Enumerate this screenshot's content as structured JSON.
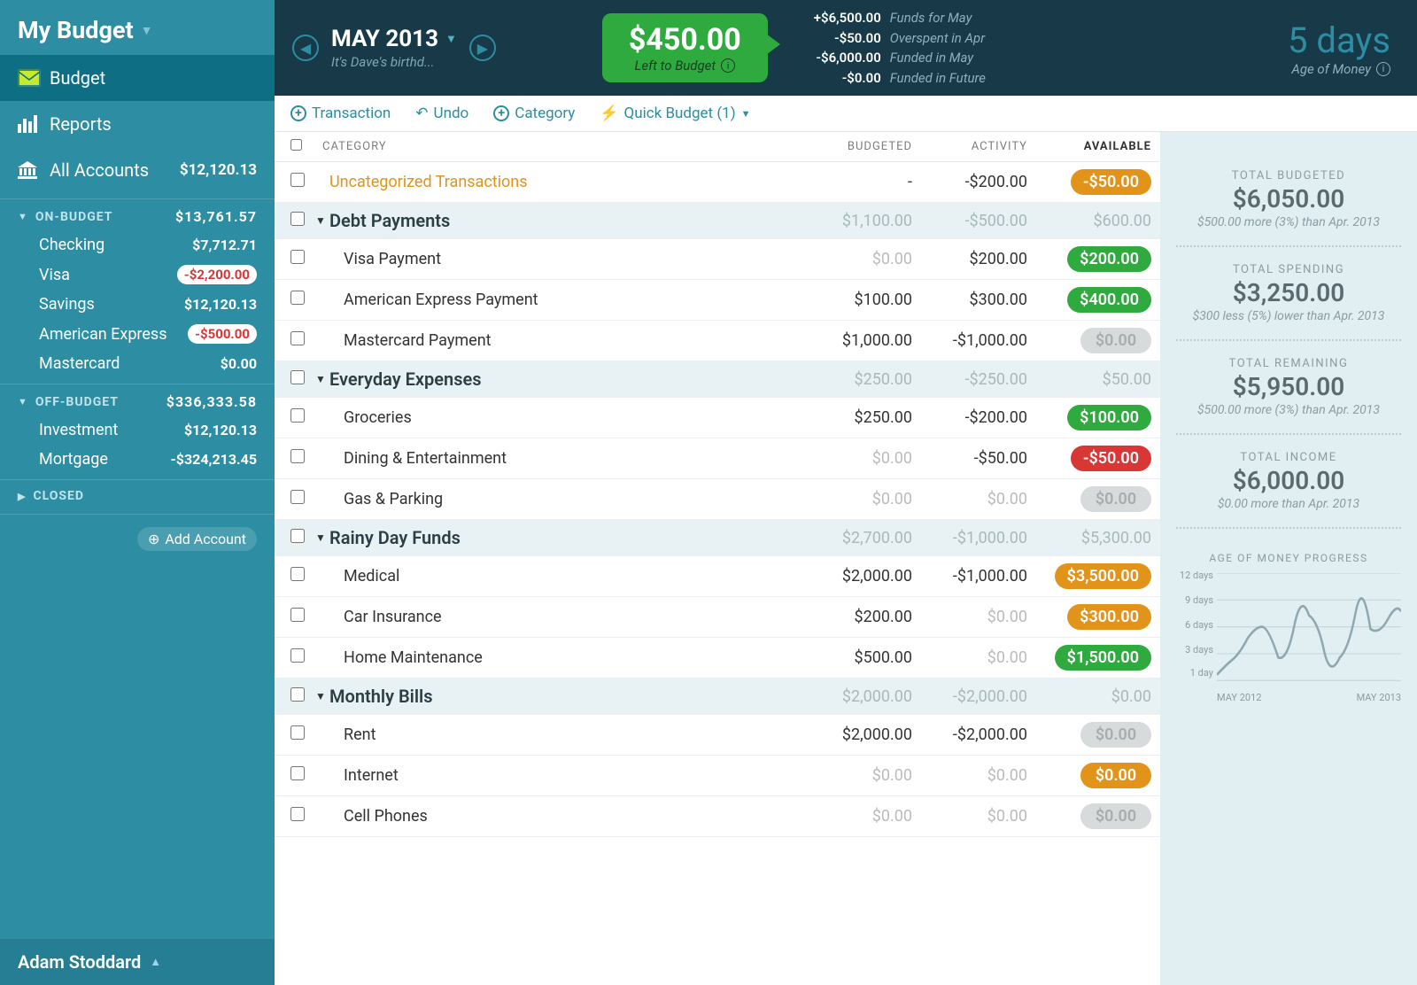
{
  "sidebar": {
    "budget_name": "My Budget",
    "nav": {
      "budget": "Budget",
      "reports": "Reports",
      "all_accounts": "All Accounts",
      "all_accounts_balance": "$12,120.13"
    },
    "on_budget": {
      "label": "ON-BUDGET",
      "total": "$13,761.57",
      "accounts": [
        {
          "name": "Checking",
          "bal": "$7,712.71",
          "neg": false
        },
        {
          "name": "Visa",
          "bal": "-$2,200.00",
          "neg": true
        },
        {
          "name": "Savings",
          "bal": "$12,120.13",
          "neg": false
        },
        {
          "name": "American Express",
          "bal": "-$500.00",
          "neg": true
        },
        {
          "name": "Mastercard",
          "bal": "$0.00",
          "neg": false
        }
      ]
    },
    "off_budget": {
      "label": "OFF-BUDGET",
      "total": "$336,333.58",
      "accounts": [
        {
          "name": "Investment",
          "bal": "$12,120.13",
          "neg": false
        },
        {
          "name": "Mortgage",
          "bal": "-$324,213.45",
          "neg": false
        }
      ]
    },
    "closed_label": "CLOSED",
    "add_account": "Add Account",
    "user": "Adam Stoddard"
  },
  "header": {
    "month": "MAY 2013",
    "subtitle": "It's Dave's birthd...",
    "ltb_amount": "$450.00",
    "ltb_label": "Left to Budget",
    "summary": [
      {
        "val": "+$6,500.00",
        "lbl": "Funds for May"
      },
      {
        "val": "-$50.00",
        "lbl": "Overspent in Apr"
      },
      {
        "val": "-$6,000.00",
        "lbl": "Funded in May"
      },
      {
        "val": "-$0.00",
        "lbl": "Funded in Future"
      }
    ],
    "age_value": "5 days",
    "age_label": "Age of Money"
  },
  "toolbar": {
    "transaction": "Transaction",
    "undo": "Undo",
    "category": "Category",
    "quick_budget": "Quick Budget (1)"
  },
  "table": {
    "headers": {
      "category": "CATEGORY",
      "budgeted": "BUDGETED",
      "activity": "ACTIVITY",
      "available": "AVAILABLE"
    },
    "uncategorized": {
      "name": "Uncategorized Transactions",
      "budgeted": "-",
      "activity": "-$200.00",
      "available": "-$50.00",
      "pill": "orange"
    },
    "groups": [
      {
        "name": "Debt Payments",
        "budgeted": "$1,100.00",
        "activity": "-$500.00",
        "available": "$600.00",
        "rows": [
          {
            "name": "Visa Payment",
            "budgeted": "$0.00",
            "budgeted_muted": true,
            "activity": "$200.00",
            "available": "$200.00",
            "pill": "green"
          },
          {
            "name": "American Express Payment",
            "budgeted": "$100.00",
            "activity": "$300.00",
            "available": "$400.00",
            "pill": "green"
          },
          {
            "name": "Mastercard Payment",
            "budgeted": "$1,000.00",
            "activity": "-$1,000.00",
            "available": "$0.00",
            "pill": "grey"
          }
        ]
      },
      {
        "name": "Everyday Expenses",
        "budgeted": "$250.00",
        "activity": "-$250.00",
        "available": "$50.00",
        "rows": [
          {
            "name": "Groceries",
            "budgeted": "$250.00",
            "activity": "-$200.00",
            "available": "$100.00",
            "pill": "green"
          },
          {
            "name": "Dining & Entertainment",
            "budgeted": "$0.00",
            "budgeted_muted": true,
            "activity": "-$50.00",
            "available": "-$50.00",
            "pill": "red"
          },
          {
            "name": "Gas & Parking",
            "budgeted": "$0.00",
            "budgeted_muted": true,
            "activity": "$0.00",
            "activity_muted": true,
            "available": "$0.00",
            "pill": "grey"
          }
        ]
      },
      {
        "name": "Rainy Day Funds",
        "budgeted": "$2,700.00",
        "activity": "-$1,000.00",
        "available": "$5,300.00",
        "rows": [
          {
            "name": "Medical",
            "budgeted": "$2,000.00",
            "activity": "-$1,000.00",
            "available": "$3,500.00",
            "pill": "orange"
          },
          {
            "name": "Car Insurance",
            "budgeted": "$200.00",
            "activity": "$0.00",
            "activity_muted": true,
            "available": "$300.00",
            "pill": "orange"
          },
          {
            "name": "Home Maintenance",
            "budgeted": "$500.00",
            "activity": "$0.00",
            "activity_muted": true,
            "available": "$1,500.00",
            "pill": "green"
          }
        ]
      },
      {
        "name": "Monthly Bills",
        "budgeted": "$2,000.00",
        "activity": "-$2,000.00",
        "available": "$0.00",
        "rows": [
          {
            "name": "Rent",
            "budgeted": "$2,000.00",
            "activity": "-$2,000.00",
            "available": "$0.00",
            "pill": "grey"
          },
          {
            "name": "Internet",
            "budgeted": "$0.00",
            "budgeted_muted": true,
            "activity": "$0.00",
            "activity_muted": true,
            "available": "$0.00",
            "pill": "orange"
          },
          {
            "name": "Cell Phones",
            "budgeted": "$0.00",
            "budgeted_muted": true,
            "activity": "$0.00",
            "activity_muted": true,
            "available": "$0.00",
            "pill": "grey"
          }
        ]
      }
    ]
  },
  "right": {
    "stats": [
      {
        "title": "TOTAL BUDGETED",
        "value": "$6,050.00",
        "sub": "$500.00 more (3%) than Apr. 2013"
      },
      {
        "title": "TOTAL SPENDING",
        "value": "$3,250.00",
        "sub": "$300 less (5%) lower than Apr. 2013"
      },
      {
        "title": "TOTAL REMAINING",
        "value": "$5,950.00",
        "sub": "$500.00 more (3%) than Apr. 2013"
      },
      {
        "title": "TOTAL INCOME",
        "value": "$6,000.00",
        "sub": "$0.00 more than Apr. 2013"
      }
    ],
    "chart_title": "AGE OF MONEY PROGRESS",
    "chart_y": [
      "12 days",
      "9 days",
      "6 days",
      "3 days",
      "1 day"
    ],
    "chart_x": [
      "MAY 2012",
      "MAY 2013"
    ]
  },
  "chart_data": {
    "type": "line",
    "title": "Age of Money Progress",
    "xlabel": "",
    "ylabel": "days",
    "ylim": [
      1,
      12
    ],
    "x_range": [
      "May 2012",
      "May 2013"
    ],
    "series": [
      {
        "name": "Age of Money",
        "y": [
          1.5,
          3,
          5,
          6,
          5,
          3.5,
          6.5,
          7,
          4,
          3.5,
          8,
          6,
          8
        ]
      }
    ]
  }
}
